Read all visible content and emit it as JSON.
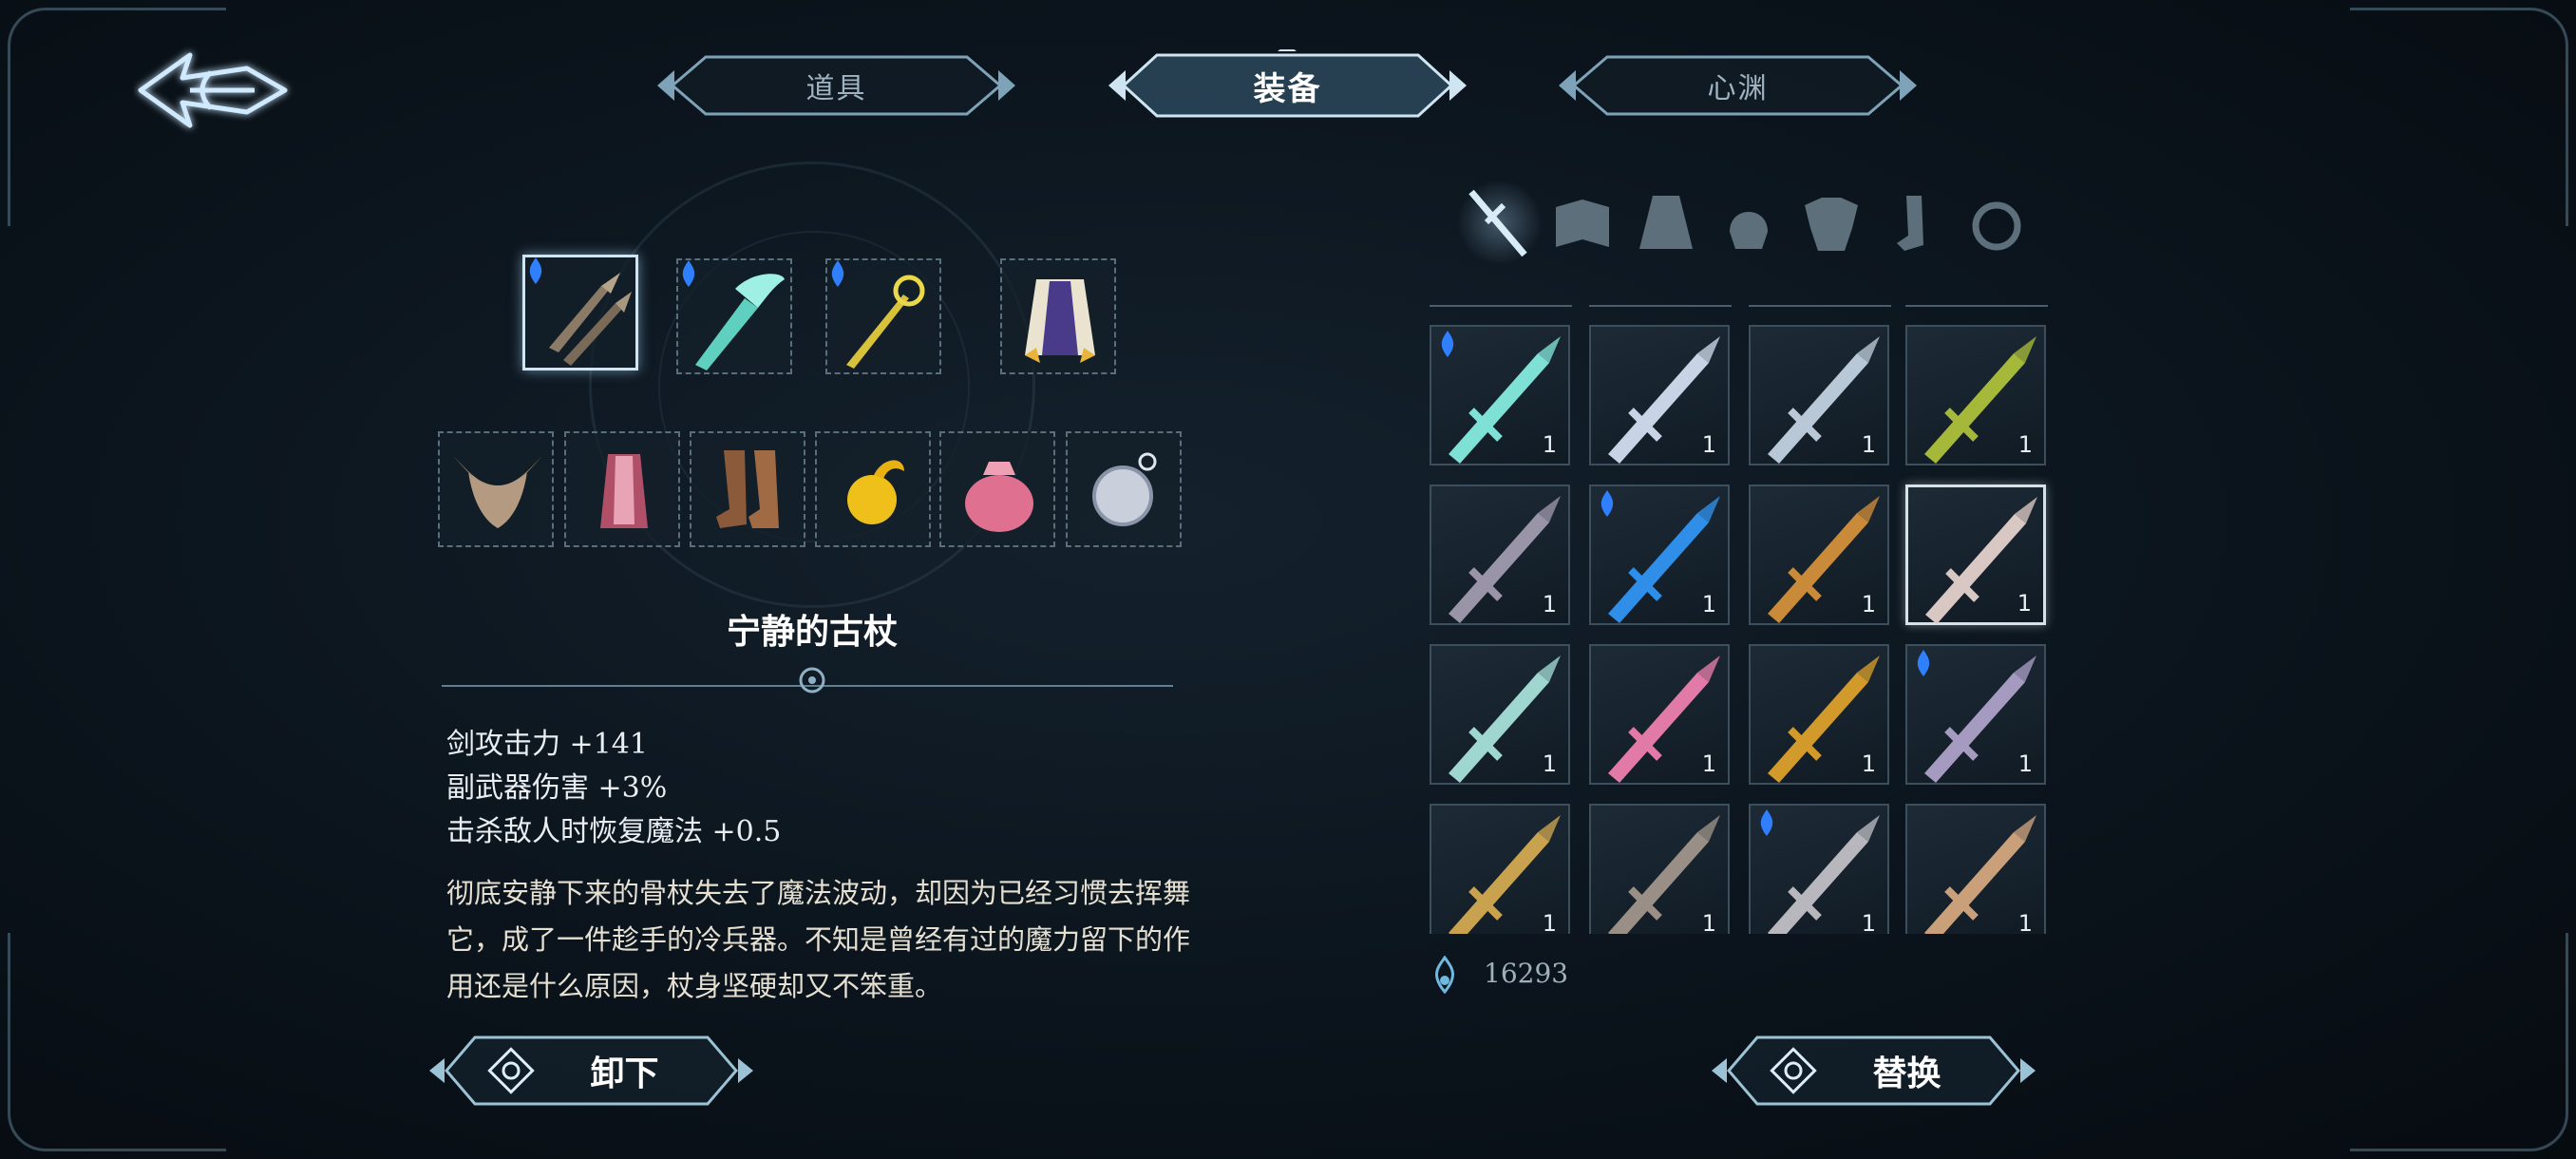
{
  "tabs": [
    {
      "label": "道具",
      "active": false
    },
    {
      "label": "装备",
      "active": true
    },
    {
      "label": "心渊",
      "active": false
    }
  ],
  "equipped": {
    "row1": [
      {
        "icon": "twin-daggers-icon",
        "gem": true,
        "selected": true
      },
      {
        "icon": "ice-sword-icon",
        "gem": true,
        "selected": false
      },
      {
        "icon": "gold-staff-icon",
        "gem": true,
        "selected": false
      },
      {
        "icon": "cape-icon",
        "gem": false,
        "selected": false
      }
    ],
    "row2": [
      {
        "icon": "horned-helmet-icon"
      },
      {
        "icon": "red-garment-icon"
      },
      {
        "icon": "boots-icon"
      },
      {
        "icon": "golden-orb-icon"
      },
      {
        "icon": "pink-pouch-icon"
      },
      {
        "icon": "silver-amulet-icon"
      }
    ]
  },
  "selected_item": {
    "name": "宁静的古杖",
    "stats": [
      "剑攻击力 +141",
      "副武器伤害 +3%",
      "击杀敌人时恢复魔法 +0.5"
    ],
    "description_lines": [
      "彻底安静下来的骨杖失去了魔法波动，却因为已经习惯去挥舞",
      "它，成了一件趁手的冷兵器。不知是曾经有过的魔力留下的作",
      "用还是什么原因，杖身坚硬却又不笨重。"
    ]
  },
  "filters": [
    {
      "icon": "sword-icon",
      "active": true
    },
    {
      "icon": "book-icon",
      "active": false
    },
    {
      "icon": "cloak-icon",
      "active": false
    },
    {
      "icon": "helmet-icon",
      "active": false
    },
    {
      "icon": "armor-icon",
      "active": false
    },
    {
      "icon": "boots-icon",
      "active": false
    },
    {
      "icon": "ring-icon",
      "active": false
    }
  ],
  "inventory": [
    {
      "icon": "ice-greatsword-icon",
      "count": "1",
      "gem": true,
      "highlight": false,
      "color": "#7fe0d6"
    },
    {
      "icon": "silver-spear-icon",
      "count": "1",
      "gem": false,
      "highlight": false,
      "color": "#c9d3e6"
    },
    {
      "icon": "orb-staff-icon",
      "count": "1",
      "gem": false,
      "highlight": false,
      "color": "#b9c8d6"
    },
    {
      "icon": "green-rapier-icon",
      "count": "1",
      "gem": false,
      "highlight": false,
      "color": "#a5b83a"
    },
    {
      "icon": "steel-sword-icon",
      "count": "1",
      "gem": false,
      "highlight": false,
      "color": "#9a94a8"
    },
    {
      "icon": "blue-crystal-sword-icon",
      "count": "1",
      "gem": true,
      "highlight": false,
      "color": "#2f8ee8"
    },
    {
      "icon": "bronze-sword-icon",
      "count": "1",
      "gem": false,
      "highlight": false,
      "color": "#c98a3a"
    },
    {
      "icon": "bone-staff-icon",
      "count": "1",
      "gem": false,
      "highlight": true,
      "color": "#d9c7c3"
    },
    {
      "icon": "jade-staff-icon",
      "count": "1",
      "gem": false,
      "highlight": false,
      "color": "#9fd6cf"
    },
    {
      "icon": "pink-blade-icon",
      "count": "1",
      "gem": false,
      "highlight": false,
      "color": "#e27aa8"
    },
    {
      "icon": "ruby-sword-icon",
      "count": "1",
      "gem": false,
      "highlight": false,
      "color": "#d19a2b"
    },
    {
      "icon": "violet-sword-icon",
      "count": "1",
      "gem": true,
      "highlight": false,
      "color": "#a59ac0"
    },
    {
      "icon": "gold-rapier-icon",
      "count": "1",
      "gem": false,
      "highlight": false,
      "color": "#c9a24f"
    },
    {
      "icon": "dark-spear-icon",
      "count": "1",
      "gem": false,
      "highlight": false,
      "color": "#9a8f86"
    },
    {
      "icon": "long-sword-icon",
      "count": "1",
      "gem": true,
      "highlight": false,
      "color": "#b7b7bd"
    },
    {
      "icon": "copper-spear-icon",
      "count": "1",
      "gem": false,
      "highlight": false,
      "color": "#c9a07a"
    }
  ],
  "currency": {
    "icon": "soul-drop-icon",
    "value": "16293"
  },
  "buttons": {
    "unequip": "卸下",
    "replace": "替换"
  },
  "colors": {
    "accent": "#cfe6f2",
    "gem": "#2f7fff",
    "frame": "#7ea3b8"
  }
}
